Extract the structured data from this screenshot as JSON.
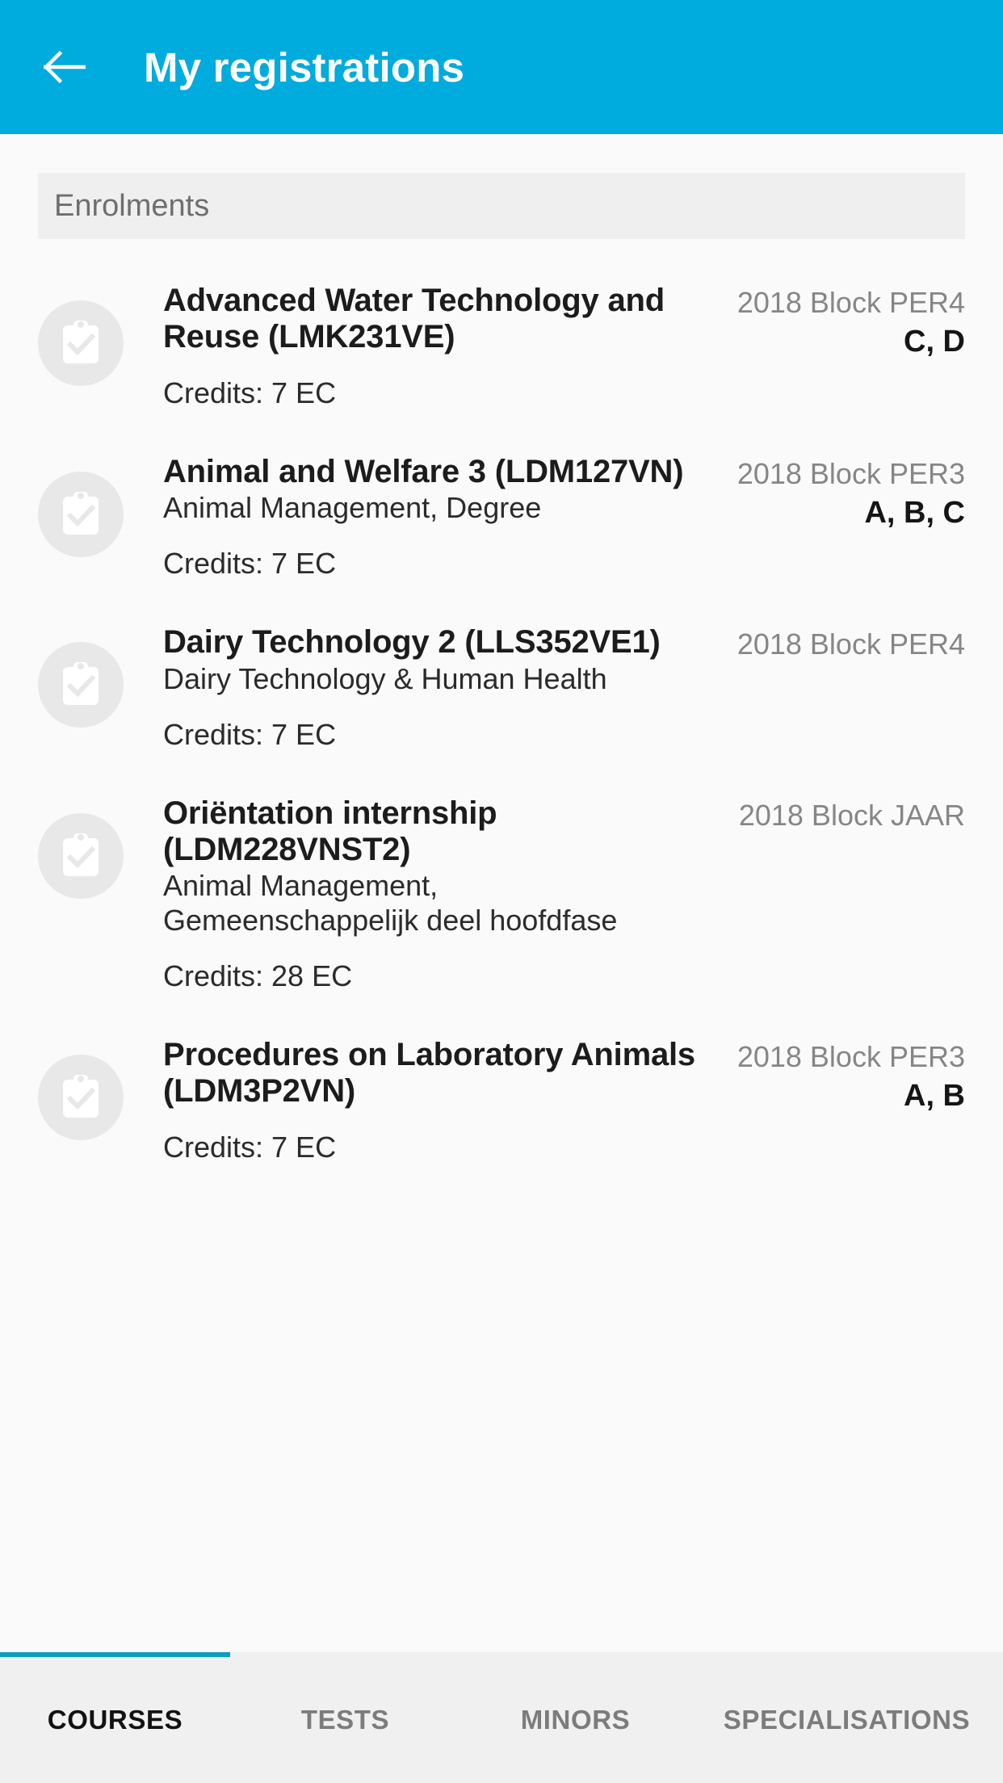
{
  "theme": {
    "header_color": "#00abde",
    "tab_indicator_color": "#0d9cc4",
    "content_background": "#fafafa",
    "banner_background": "#efefef",
    "icon_circle_color": "#e8e8e8"
  },
  "header": {
    "back_icon": "arrow-left-icon",
    "title": "My registrations"
  },
  "section": {
    "label": "Enrolments"
  },
  "courses": [
    {
      "icon": "clipboard-check-icon",
      "title": "Advanced Water Technology and Reuse (LMK231VE)",
      "subtitle": "",
      "credits": "Credits: 7 EC",
      "period": "2018 Block PER4",
      "blocks": "C, D"
    },
    {
      "icon": "clipboard-check-icon",
      "title": "Animal and Welfare 3 (LDM127VN)",
      "subtitle": "Animal Management, Degree",
      "credits": "Credits: 7 EC",
      "period": "2018 Block PER3",
      "blocks": "A, B, C"
    },
    {
      "icon": "clipboard-check-icon",
      "title": "Dairy Technology 2 (LLS352VE1)",
      "subtitle": "Dairy Technology & Human Health",
      "credits": "Credits: 7 EC",
      "period": "2018 Block PER4",
      "blocks": ""
    },
    {
      "icon": "clipboard-check-icon",
      "title": "Oriëntation internship (LDM228VNST2)",
      "subtitle": "Animal Management, Gemeenschappelijk deel hoofdfase",
      "credits": "Credits: 28 EC",
      "period": "2018 Block JAAR",
      "blocks": ""
    },
    {
      "icon": "clipboard-check-icon",
      "title": "Procedures on Laboratory Animals (LDM3P2VN)",
      "subtitle": "",
      "credits": "Credits: 7 EC",
      "period": "2018 Block PER3",
      "blocks": "A, B"
    }
  ],
  "tabs": [
    {
      "label": "COURSES",
      "active": true
    },
    {
      "label": "TESTS",
      "active": false
    },
    {
      "label": "MINORS",
      "active": false
    },
    {
      "label": "SPECIALISATIONS",
      "active": false
    }
  ]
}
